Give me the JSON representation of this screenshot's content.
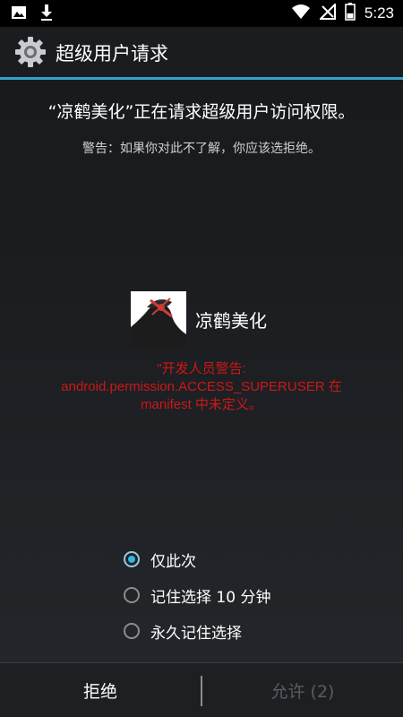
{
  "status_bar": {
    "time": "5:23",
    "left_icons": [
      "image-icon",
      "download-icon"
    ],
    "right_icons": [
      "wifi-icon",
      "no-signal-icon",
      "battery-icon"
    ],
    "battery_level": 0.4
  },
  "action_bar": {
    "title": "超级用户请求",
    "icon": "gear-icon"
  },
  "request": {
    "message": "“凉鹤美化”正在请求超级用户访问权限。",
    "warning": "警告：如果你对此不了解，你应该选拒绝。"
  },
  "app": {
    "name": "凉鹤美化",
    "icon": "app-thumbnail-icon"
  },
  "developer_warning": {
    "line1": "\"开发人员警告:",
    "line2": "android.permission.ACCESS_SUPERUSER 在",
    "line3": "manifest 中未定义。"
  },
  "options": [
    {
      "label": "仅此次",
      "checked": true
    },
    {
      "label": "记住选择 10 分钟",
      "checked": false
    },
    {
      "label": "永久记住选择",
      "checked": false
    }
  ],
  "buttons": {
    "deny": "拒绝",
    "allow": "允许 (2)"
  },
  "colors": {
    "accent": "#33b5e5",
    "holo_line": "#2fa3c9",
    "warning_red": "#cc1818",
    "disabled_text": "#5a5c60"
  }
}
